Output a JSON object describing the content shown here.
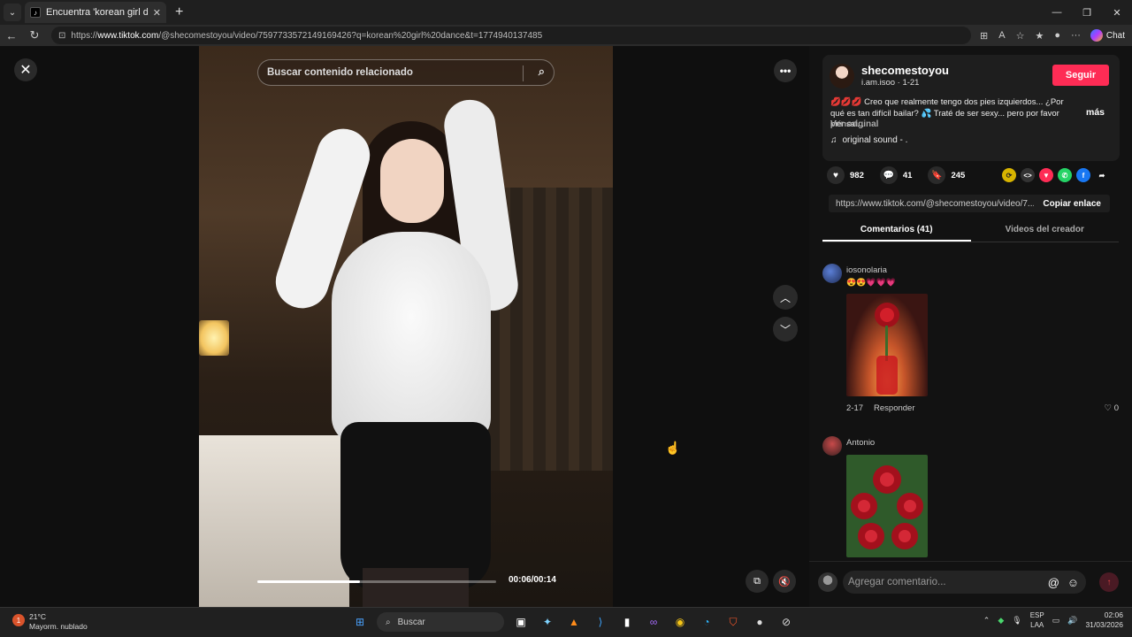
{
  "browser": {
    "tab_title": "Encuentra 'korean girl dance' en T",
    "url_prefix": "https://",
    "url_host": "www.tiktok.com",
    "url_path": "/@shecomestoyou/video/7597733572149169426?q=korean%20girl%20dance&t=1774940137485",
    "chat_label": "Chat"
  },
  "video": {
    "search_placeholder": "Buscar contenido relacionado",
    "time": "00:06/00:14",
    "progress_fraction": 0.43
  },
  "post": {
    "username": "shecomestoyou",
    "handle": "i.am.isoo · 1-21",
    "follow_label": "Seguir",
    "description": "💋💋💋 Creo que realmente tengo dos pies izquierdos... ¿Por qué es tan difícil bailar? 💦 Traté de ser sexy... pero por favor piénsal...",
    "more_label": "más",
    "see_original": "Ver original",
    "sound": "original sound - .",
    "likes": "982",
    "comments": "41",
    "saves": "245",
    "share_link": "https://www.tiktok.com/@shecomestoyou/video/7...",
    "copy_link_label": "Copiar enlace"
  },
  "tabs": {
    "comments": "Comentarios (41)",
    "creator_videos": "Videos del creador"
  },
  "comments": [
    {
      "user": "iosonolaria",
      "emojis": "😍😍💗💗💗",
      "date": "2-17",
      "reply_label": "Responder",
      "likes": "0"
    },
    {
      "user": "Antonio"
    }
  ],
  "composer": {
    "placeholder": "Agregar comentario..."
  },
  "taskbar": {
    "temp": "21°C",
    "weather": "Mayorm. nublado",
    "search": "Buscar",
    "lang1": "ESP",
    "lang2": "LAA",
    "time": "02:06",
    "date": "31/03/2026"
  },
  "colors": {
    "follow_button": "#fe2c55",
    "background": "#121212"
  }
}
